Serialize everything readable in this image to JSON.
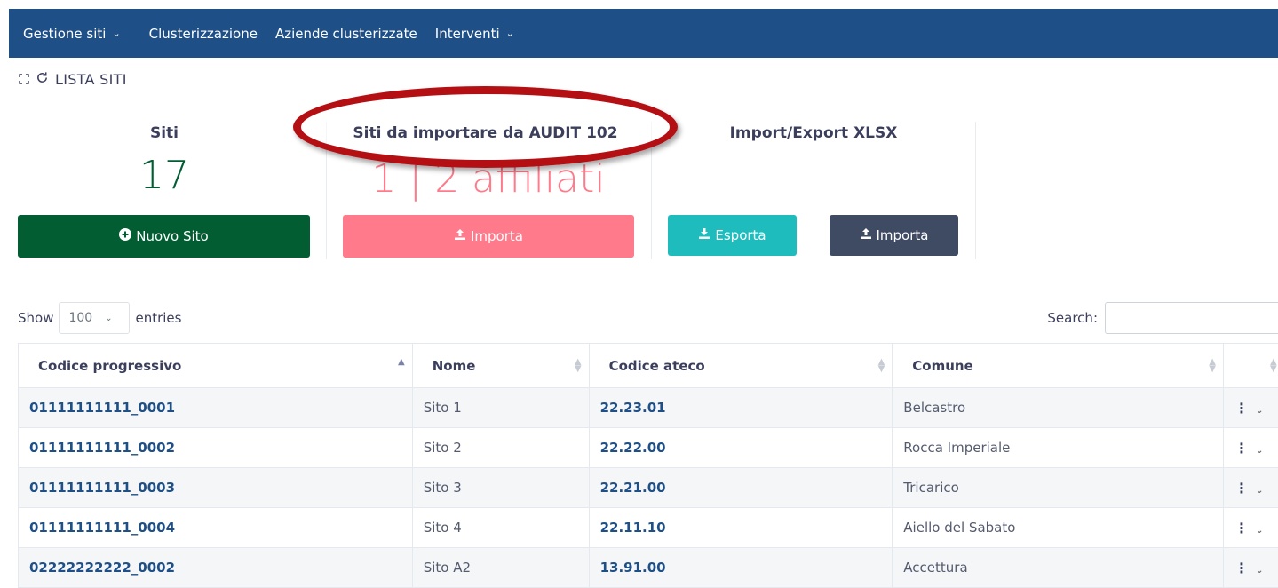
{
  "nav": {
    "items": [
      {
        "label": "Gestione siti",
        "has_dropdown": true
      },
      {
        "label": "Clusterizzazione",
        "has_dropdown": false
      },
      {
        "label": "Aziende clusterizzate",
        "has_dropdown": false
      },
      {
        "label": "Interventi",
        "has_dropdown": true
      }
    ],
    "background": "#1e4f86"
  },
  "section": {
    "title": "LISTA SITI",
    "icons": [
      "fullscreen-icon",
      "refresh-icon"
    ]
  },
  "panels": {
    "siti": {
      "title": "Siti",
      "count": "17",
      "button_label": "Nuovo Sito",
      "button_color": "#025d33"
    },
    "audit": {
      "title": "Siti da importare da AUDIT 102",
      "count": "1 | 2 affiliati",
      "button_label": "Importa",
      "button_color": "#ff7a8a"
    },
    "xlsx": {
      "title": "Import/Export XLSX",
      "export_label": "Esporta",
      "export_color": "#1fbcbe",
      "import_label": "Importa",
      "import_color": "#3f4a63"
    }
  },
  "table_controls": {
    "show_label": "Show",
    "entries_value": "100",
    "entries_label": "entries",
    "search_label": "Search:",
    "search_value": ""
  },
  "table": {
    "columns": [
      "Codice progressivo",
      "Nome",
      "Codice ateco",
      "Comune",
      ""
    ],
    "sorted_column": 0,
    "rows": [
      {
        "codice": "01111111111_0001",
        "nome": "Sito 1",
        "ateco": "22.23.01",
        "comune": "Belcastro"
      },
      {
        "codice": "01111111111_0002",
        "nome": "Sito 2",
        "ateco": "22.22.00",
        "comune": "Rocca Imperiale"
      },
      {
        "codice": "01111111111_0003",
        "nome": "Sito 3",
        "ateco": "22.21.00",
        "comune": "Tricarico"
      },
      {
        "codice": "01111111111_0004",
        "nome": "Sito 4",
        "ateco": "22.11.10",
        "comune": "Aiello del Sabato"
      },
      {
        "codice": "02222222222_0002",
        "nome": "Sito A2",
        "ateco": "13.91.00",
        "comune": "Accettura"
      }
    ]
  },
  "annotation": {
    "color": "#b40f13"
  }
}
